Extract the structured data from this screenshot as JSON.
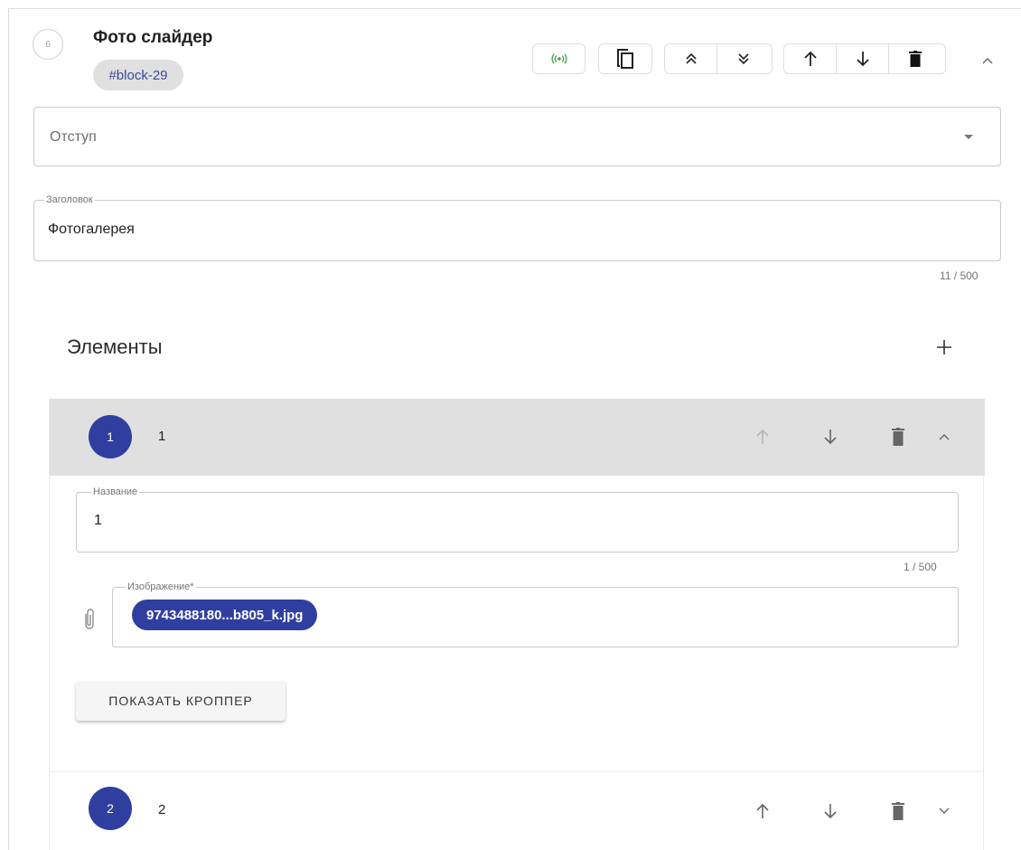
{
  "block": {
    "index": "6",
    "title": "Фото слайдер",
    "anchor_chip": "#block-29"
  },
  "toolbar": {
    "live_icon": "broadcast-icon",
    "copy_icon": "copy-icon",
    "expand_all_icon": "double-chevron-up-icon",
    "collapse_all_icon": "double-chevron-down-icon",
    "move_up_icon": "arrow-up-icon",
    "move_down_icon": "arrow-down-icon",
    "delete_icon": "trash-icon",
    "collapse_icon": "chevron-up-icon",
    "live_color": "#43a047"
  },
  "indent_select": {
    "placeholder": "Отступ"
  },
  "title_field": {
    "label": "Заголовок",
    "value": "Фотогалерея",
    "counter": "11 / 500"
  },
  "elements": {
    "section_label": "Элементы",
    "items": [
      {
        "number": "1",
        "label": "1",
        "expanded": true,
        "name_field": {
          "label": "Название",
          "value": "1",
          "counter": "1 / 500"
        },
        "image_field": {
          "label": "Изображение*",
          "file": "9743488180...b805_k.jpg"
        },
        "crop_button": "ПОКАЗАТЬ КРОППЕР"
      },
      {
        "number": "2",
        "label": "2",
        "expanded": false
      }
    ]
  },
  "colors": {
    "accent": "#303f9f",
    "chip_bg": "#e0e0e0",
    "header_bg": "#e0e0e0"
  }
}
